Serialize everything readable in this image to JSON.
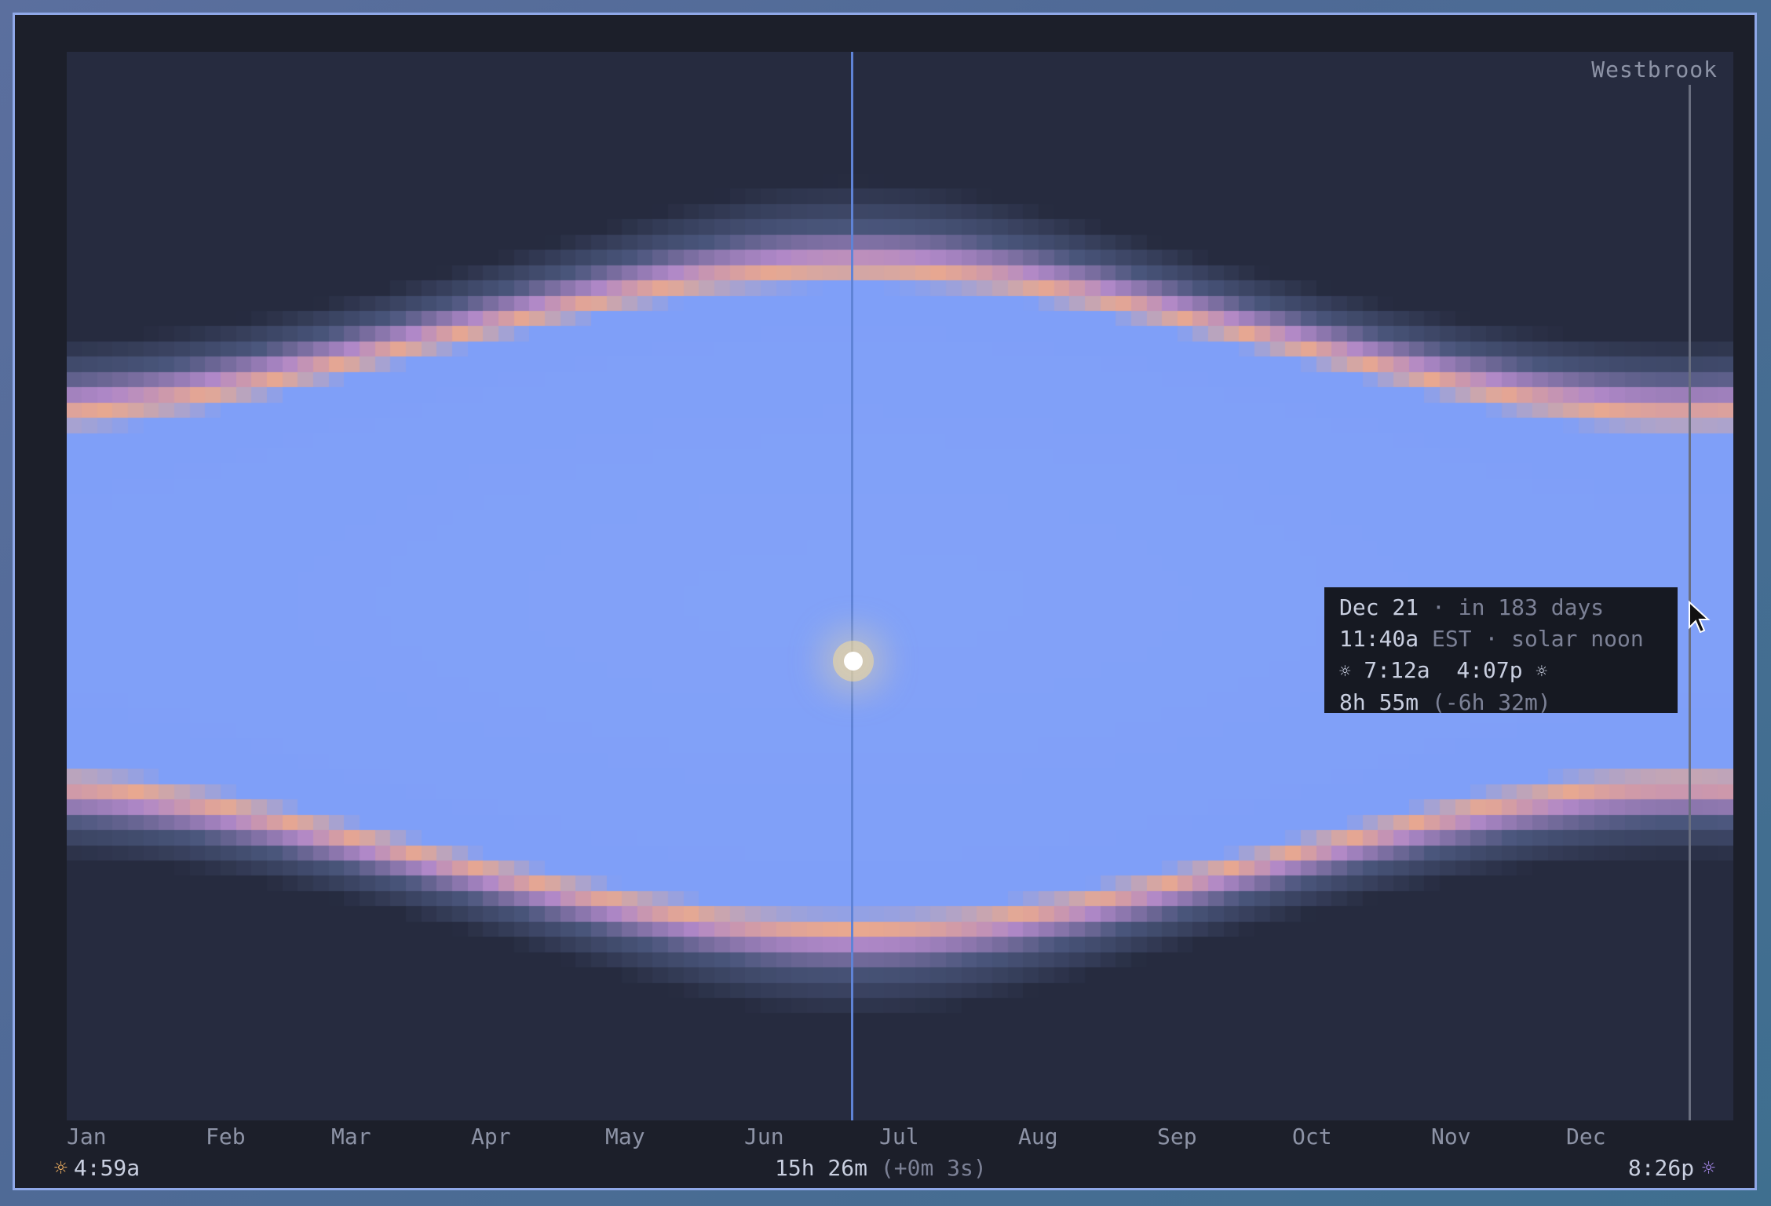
{
  "location": "Westbrook",
  "months": [
    "Jan",
    "Feb",
    "Mar",
    "Apr",
    "May",
    "Jun",
    "Jul",
    "Aug",
    "Sep",
    "Oct",
    "Nov",
    "Dec"
  ],
  "today": {
    "day_of_year": 172,
    "sunrise": "4:59a",
    "sunset": "8:26p",
    "day_length": "15h 26m",
    "day_length_delta": "(+0m 3s)"
  },
  "tooltip": {
    "date": "Dec 21",
    "relative": "· in 183 days",
    "noon_time": "11:40a",
    "noon_suffix": "EST · solar noon",
    "sunrise": "7:12a",
    "sunset": "4:07p",
    "day_length": "8h 55m",
    "delta": "(-6h 32m)",
    "day_of_year": 355
  },
  "icons": {
    "sunrise": "sunrise-icon",
    "sunset": "sunset-icon",
    "cursor": "mouse-pointer-icon"
  },
  "colors": {
    "day": "#7f9ff8",
    "night": "#262b3f",
    "twilight_peach": "#e8a890",
    "twilight_purple": "#b088c8",
    "today_line": "#5f83d6",
    "sun_glow": "#f8dc96"
  },
  "sky_data": {
    "type": "heatmap",
    "x_axis": "month",
    "y_axis": "time of day",
    "latitude_deg": 43.7
  }
}
